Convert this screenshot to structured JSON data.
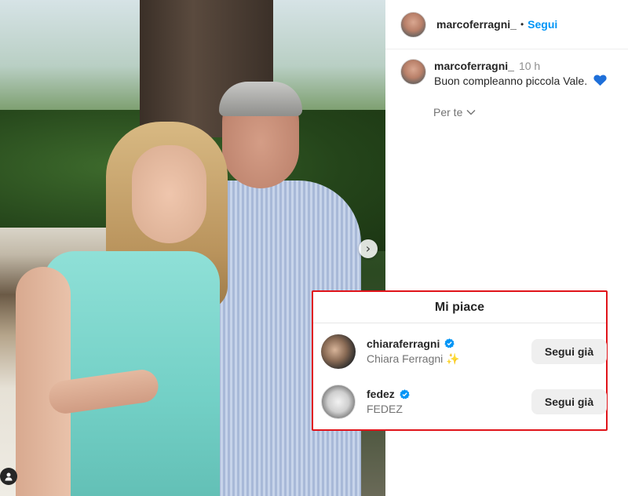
{
  "post": {
    "author": "marcoferragni_",
    "follow_label": "Segui",
    "separator": "•",
    "caption": {
      "username": "marcoferragni_",
      "time": "10 h",
      "text": "Buon compleanno piccola Vale.",
      "emoji_icon": "blue-heart-icon"
    },
    "for_you_label": "Per te"
  },
  "likes_modal": {
    "title": "Mi piace",
    "users": [
      {
        "username": "chiaraferragni",
        "full_name": "Chiara Ferragni",
        "full_name_emoji": "✨",
        "verified": true,
        "button_label": "Segui già"
      },
      {
        "username": "fedez",
        "full_name": "FEDEZ",
        "verified": true,
        "button_label": "Segui già"
      }
    ],
    "highlight_color": "#e0141a"
  },
  "colors": {
    "link_blue": "#0095f6",
    "verified_blue": "#0095f6",
    "text": "#262626",
    "muted": "#737373"
  }
}
